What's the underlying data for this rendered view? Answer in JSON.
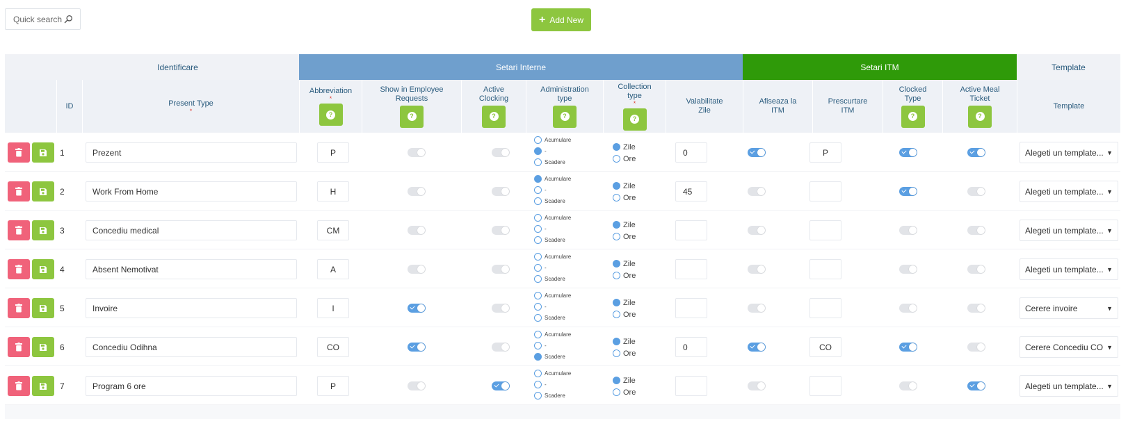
{
  "toolbar": {
    "search_placeholder": "Quick search",
    "add_new_label": "Add New",
    "colors": {
      "add_button": "#8dc63f",
      "delete_button": "#f0627a",
      "save_button": "#8dc63f"
    }
  },
  "groups": {
    "identificare": "Identificare",
    "setari_interne": "Setari Interne",
    "setari_itm": "Setari ITM",
    "template": "Template",
    "colors": {
      "setari_interne": "#6f9fcd",
      "setari_itm": "#2f9a09"
    }
  },
  "columns": {
    "id": "ID",
    "present_type": "Present Type",
    "required_mark": "*",
    "abbreviation": "Abbreviation",
    "show_in_requests": "Show in Employee Requests",
    "active_clocking": "Active Clocking",
    "administration_type": "Administration type",
    "collection_type": "Collection type",
    "valabilitate_zile": "Valabilitate Zile",
    "afiseaza_itm": "Afiseaza la ITM",
    "prescurtare_itm": "Prescurtare ITM",
    "clocked_type": "Clocked Type",
    "active_meal_ticket": "Active Meal Ticket",
    "template": "Template",
    "help_symbol": "?"
  },
  "labels": {
    "admin_options": [
      "Acumulare",
      "-",
      "Scadere"
    ],
    "collection_options": [
      "Zile",
      "Ore"
    ]
  },
  "rows": [
    {
      "id": "1",
      "name": "Prezent",
      "abbr": "P",
      "show_req": false,
      "active_clock": false,
      "admin": 1,
      "collection": 0,
      "valid": "0",
      "itm_show": true,
      "itm_abbr": "P",
      "clocked": true,
      "meal": true,
      "template": "Alegeti un template..."
    },
    {
      "id": "2",
      "name": "Work From Home",
      "abbr": "H",
      "show_req": false,
      "active_clock": false,
      "admin": 0,
      "collection": 0,
      "valid": "45",
      "itm_show": false,
      "itm_abbr": "",
      "clocked": true,
      "meal": false,
      "template": "Alegeti un template..."
    },
    {
      "id": "3",
      "name": "Concediu medical",
      "abbr": "CM",
      "show_req": false,
      "active_clock": false,
      "admin": -1,
      "collection": 0,
      "valid": "",
      "itm_show": false,
      "itm_abbr": "",
      "clocked": false,
      "meal": false,
      "template": "Alegeti un template..."
    },
    {
      "id": "4",
      "name": "Absent Nemotivat",
      "abbr": "A",
      "show_req": false,
      "active_clock": false,
      "admin": -1,
      "collection": 0,
      "valid": "",
      "itm_show": false,
      "itm_abbr": "",
      "clocked": false,
      "meal": false,
      "template": "Alegeti un template..."
    },
    {
      "id": "5",
      "name": "Invoire",
      "abbr": "I",
      "show_req": true,
      "active_clock": false,
      "admin": -1,
      "collection": 0,
      "valid": "",
      "itm_show": false,
      "itm_abbr": "",
      "clocked": false,
      "meal": false,
      "template": "Cerere invoire"
    },
    {
      "id": "6",
      "name": "Concediu Odihna",
      "abbr": "CO",
      "show_req": true,
      "active_clock": false,
      "admin": 2,
      "collection": 0,
      "valid": "0",
      "itm_show": true,
      "itm_abbr": "CO",
      "clocked": true,
      "meal": false,
      "template": "Cerere Concediu CO"
    },
    {
      "id": "7",
      "name": "Program 6 ore",
      "abbr": "P",
      "show_req": false,
      "active_clock": true,
      "admin": -1,
      "collection": 0,
      "valid": "",
      "itm_show": false,
      "itm_abbr": "",
      "clocked": false,
      "meal": true,
      "template": "Alegeti un template..."
    }
  ]
}
